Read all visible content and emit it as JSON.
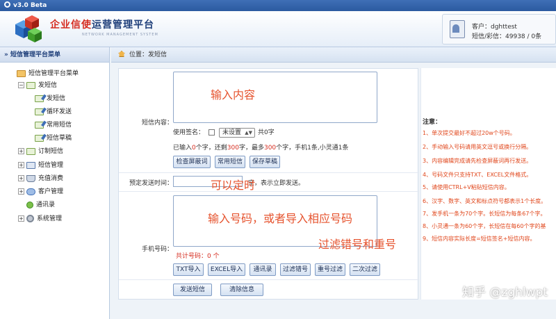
{
  "app": {
    "version_title": "v3.0 Beta",
    "brand_prefix": "企业信使",
    "brand_suffix": "运营管理平台",
    "brand_sub": "NETWORK MANAGEMENT SYSTEM"
  },
  "account": {
    "customer": "客户：dghttest",
    "balance": "短信/彩信：49938 / 0条"
  },
  "sidebar": {
    "title": "» 短信管理平台菜单",
    "root": "短信管理平台菜单",
    "items": [
      {
        "label": "发短信",
        "expander": "−"
      },
      {
        "label": "发短信"
      },
      {
        "label": "循环发送"
      },
      {
        "label": "常用短信"
      },
      {
        "label": "短信草稿"
      },
      {
        "label": "订制短信",
        "expander": "+"
      },
      {
        "label": "短信管理",
        "expander": "+"
      },
      {
        "label": "充值消费",
        "expander": "+"
      },
      {
        "label": "客户管理",
        "expander": "+"
      },
      {
        "label": "通讯录"
      },
      {
        "label": "系统管理",
        "expander": "+"
      }
    ]
  },
  "breadcrumb": "位置：发短信",
  "form": {
    "content_label": "短信内容：",
    "content_note": "输入内容",
    "signature_label": "使用签名：",
    "signature_value": "未设置",
    "char_count": "共0字",
    "counter": {
      "p1": "已输入",
      "n1": "0",
      "p2": "个字，还剩",
      "n2": "300",
      "p3": "字，最多",
      "n3": "300",
      "p4": "个字，手机1条,小灵通1条"
    },
    "buttons_content": [
      "检查屏蔽词",
      "常用短信",
      "保存草稿"
    ],
    "schedule_label": "预定发送时间：",
    "schedule_hint": "空，表示立即发送。",
    "schedule_note": "可以定时",
    "phone_label": "手机号码：",
    "phone_note": "输入号码，或者导入相应号码",
    "phone_count": "共计号码：0 个",
    "buttons_phone": [
      "TXT导入",
      "EXCEL导入",
      "通讯录",
      "过滤错号",
      "重号过滤",
      "二次过滤"
    ],
    "buttons_bottom": [
      "发送短信",
      "清除信息"
    ],
    "bottom_note": "过滤错号和重号"
  },
  "notes": {
    "title": "注意：",
    "items": [
      "1、单次提交最好不超过20w个号码。",
      "2、手动输入号码请用英文逗号或换行分隔。",
      "3、内容编辑完成请先检查屏蔽词再行发送。",
      "4、号码文件只支持TXT、EXCEL文件格式。",
      "5、请使用CTRL+V粘贴短信内容。",
      "6、汉字、数字、英文和标点符号都表示1个长度。",
      "7、发手机一条为70个字。长短信为每条67个字。",
      "8、小灵通一条为60个字，长短信在每60个字的基",
      "9、短信内容实际长度=短信签名+短信内容。"
    ]
  },
  "watermark": "知乎 @zghlwpt",
  "colors": {
    "accent_red": "#d52b1e",
    "note_orange": "#e6532e",
    "brand_blue": "#1f3f7a"
  }
}
